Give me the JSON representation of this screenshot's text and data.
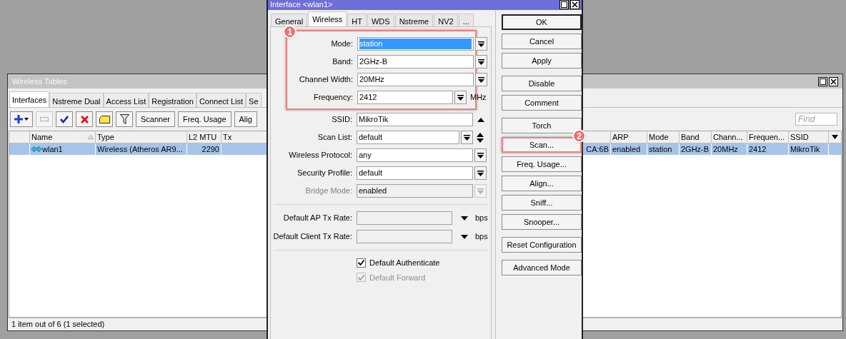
{
  "wireless_tables": {
    "title": "Wireless Tables",
    "tabs": [
      {
        "label": "Interfaces",
        "selected": true
      },
      {
        "label": "Nstreme Dual",
        "selected": false
      },
      {
        "label": "Access List",
        "selected": false
      },
      {
        "label": "Registration",
        "selected": false
      },
      {
        "label": "Connect List",
        "selected": false
      },
      {
        "label": "Se",
        "selected": false
      }
    ],
    "toolbar": [
      {
        "kind": "add",
        "disabled": false
      },
      {
        "kind": "remove",
        "disabled": true
      },
      {
        "kind": "enable",
        "disabled": false
      },
      {
        "kind": "disable",
        "disabled": false
      },
      {
        "kind": "comment",
        "disabled": false
      },
      {
        "kind": "filter",
        "disabled": false
      },
      {
        "kind": "text",
        "label": "Scanner",
        "disabled": false
      },
      {
        "kind": "text",
        "label": "Freq. Usage",
        "disabled": false
      },
      {
        "kind": "text",
        "label": "Alig",
        "disabled": false
      }
    ],
    "find": {
      "placeholder": "Find"
    },
    "table": {
      "columns": [
        {
          "label": "Name",
          "sorted": true
        },
        {
          "label": "Type",
          "sorted": false
        },
        {
          "label": "L2 MTU",
          "sorted": false
        },
        {
          "label": "Tx",
          "sorted": false
        },
        {
          "sorted": false
        },
        {
          "label": "ARP",
          "sorted": false
        },
        {
          "label": "Mode",
          "sorted": false
        },
        {
          "label": "Band",
          "sorted": false
        },
        {
          "label": "Chann...",
          "sorted": false
        },
        {
          "label": "Frequen...",
          "sorted": false
        },
        {
          "label": "SSID",
          "sorted": false
        }
      ],
      "rows": [
        {
          "selected": true,
          "cells": [
            "wlan1",
            "Wireless (Atheros AR9...",
            "2290",
            null,
            "CA:6B",
            "enabled",
            "station",
            "2GHz-B",
            "20MHz",
            "2412",
            "MikroTik"
          ]
        }
      ]
    },
    "status_bar": "1 item out of 6 (1 selected)"
  },
  "dialog": {
    "title": "Interface <wlan1>",
    "tabs": [
      {
        "label": "General",
        "selected": false
      },
      {
        "label": "Wireless",
        "selected": true
      },
      {
        "label": "HT",
        "selected": false
      },
      {
        "label": "WDS",
        "selected": false
      },
      {
        "label": "Nstreme",
        "selected": false
      },
      {
        "label": "NV2",
        "selected": false
      },
      {
        "label": "...",
        "selected": false
      }
    ],
    "highlight": {
      "badge": "1",
      "fields": [
        {
          "kind": "select",
          "label": "Mode:",
          "value": "station",
          "text_selected": true,
          "disabled": false
        },
        {
          "kind": "select",
          "label": "Band:",
          "value": "2GHz-B",
          "text_selected": false,
          "disabled": false
        },
        {
          "kind": "select",
          "label": "Channel Width:",
          "value": "20MHz",
          "text_selected": false,
          "disabled": false
        },
        {
          "kind": "select_unit",
          "label": "Frequency:",
          "value": "2412",
          "unit": "MHz",
          "text_selected": false,
          "disabled": false
        }
      ]
    },
    "fields": [
      {
        "kind": "text_up",
        "label": "SSID:",
        "value": "MikroTik",
        "disabled": false
      },
      {
        "kind": "select_updown",
        "label": "Scan List:",
        "value": "default",
        "disabled": false
      },
      {
        "kind": "select",
        "label": "Wireless Protocol:",
        "value": "any",
        "disabled": false
      },
      {
        "kind": "select",
        "label": "Security Profile:",
        "value": "default",
        "disabled": false
      },
      {
        "kind": "select",
        "label": "Bridge Mode:",
        "value": "enabled",
        "disabled": true
      }
    ],
    "rate_fields": [
      {
        "label": "Default AP Tx Rate:",
        "unit": "bps"
      },
      {
        "label": "Default Client Tx Rate:",
        "unit": "bps"
      }
    ],
    "checkboxes": [
      {
        "label": "Default Authenticate",
        "checked": true,
        "disabled": false
      },
      {
        "label": "Default Forward",
        "checked": true,
        "disabled": true
      }
    ],
    "button_groups": [
      [
        {
          "label": "OK",
          "default": true
        },
        {
          "label": "Cancel",
          "default": false
        },
        {
          "label": "Apply",
          "default": false
        }
      ],
      [
        {
          "label": "Disable",
          "default": false
        },
        {
          "label": "Comment",
          "default": false
        }
      ],
      [
        {
          "label": "Torch",
          "default": false
        },
        {
          "label": "Scan...",
          "default": false,
          "badge": "2"
        },
        {
          "label": "Freq. Usage...",
          "default": false
        },
        {
          "label": "Align...",
          "default": false
        },
        {
          "label": "Sniff...",
          "default": false
        },
        {
          "label": "Snooper...",
          "default": false
        }
      ],
      [
        {
          "label": "Reset Configuration",
          "default": false
        }
      ],
      [
        {
          "label": "Advanced Mode",
          "default": false
        }
      ]
    ]
  }
}
